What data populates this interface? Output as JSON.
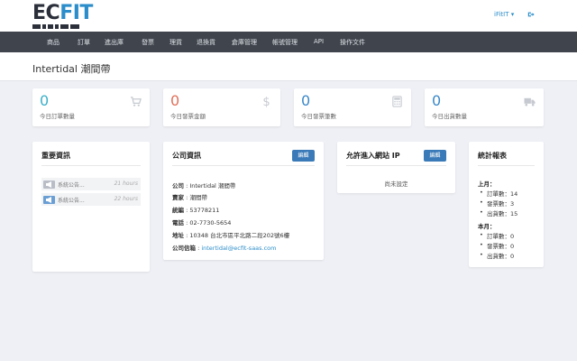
{
  "brand": {
    "ec": "EC",
    "fit": "FIT"
  },
  "header": {
    "user": "iFitIT ▾",
    "nav": [
      "商品",
      "訂單",
      "進出庫",
      "發票",
      "理貨",
      "退換貨",
      "倉庫管理",
      "帳號管理",
      "API",
      "操作文件"
    ]
  },
  "page": {
    "title": "Intertidal 潮間帶"
  },
  "stats": [
    {
      "value": "0",
      "label": "今日訂單數量",
      "color": "#3ab0c8",
      "icon": "cart-icon"
    },
    {
      "value": "0",
      "label": "今日發票金額",
      "color": "#e0705a",
      "icon": "dollar-icon"
    },
    {
      "value": "0",
      "label": "今日發票筆數",
      "color": "#3a88c8",
      "icon": "calculator-icon"
    },
    {
      "value": "0",
      "label": "今日出貨數量",
      "color": "#3a88c8",
      "icon": "truck-icon"
    }
  ],
  "news": {
    "title": "重要資訊",
    "items": [
      {
        "text": "系統公告...",
        "time": "21 hours"
      },
      {
        "text": "系統公告...",
        "time": "22 hours"
      }
    ]
  },
  "company": {
    "title": "公司資訊",
    "edit_label": "編輯",
    "lines": [
      {
        "label": "公司",
        "value": "Intertidal 潮間帶"
      },
      {
        "label": "賣家",
        "value": "潮間帶"
      },
      {
        "label": "統編",
        "value": "53778211"
      },
      {
        "label": "電話",
        "value": "02-7730-5654"
      },
      {
        "label": "地址",
        "value": "10348 台北市區平北路二段202號6樓"
      },
      {
        "label": "公司信箱",
        "value": "intertidal@ecfit-saas.com"
      }
    ]
  },
  "ip": {
    "title": "允許進入網站 IP",
    "edit_label": "編輯",
    "empty": "尚未設定"
  },
  "report": {
    "title": "統計報表",
    "groups": [
      {
        "name": "上月：",
        "items": [
          "訂單數：14",
          "發票數：3",
          "出貨數：15"
        ]
      },
      {
        "name": "本月：",
        "items": [
          "訂單數：0",
          "發票數：0",
          "出貨數：0"
        ]
      }
    ]
  }
}
